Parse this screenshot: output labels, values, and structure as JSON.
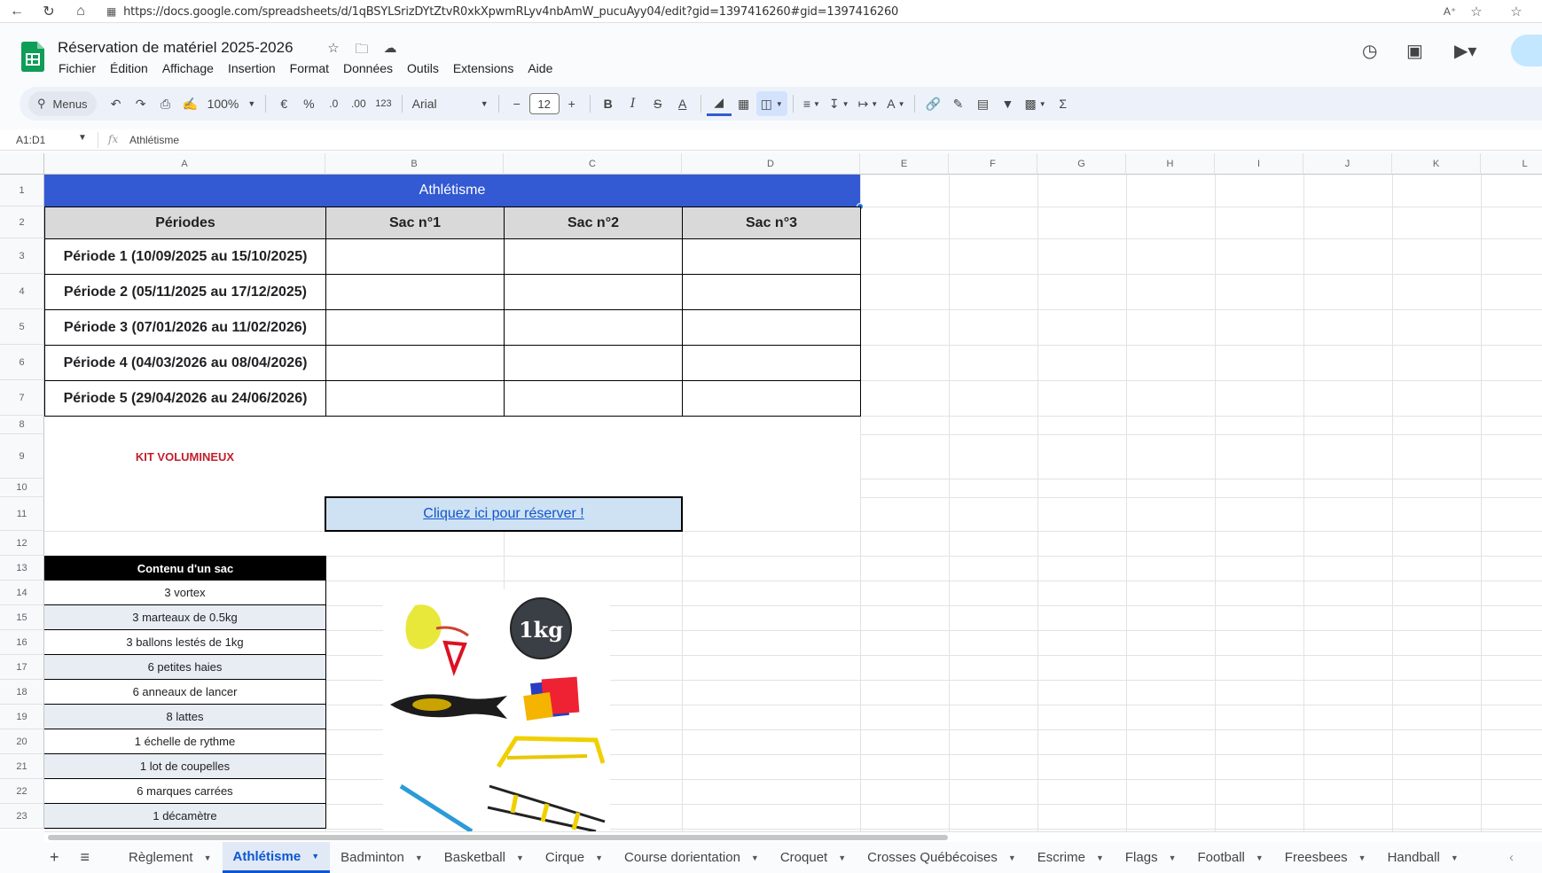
{
  "browser": {
    "url": "https://docs.google.com/spreadsheets/d/1qBSYLSrizDYtZtvR0xkXpwmRLyv4nbAmW_pucuAyy04/edit?gid=1397416260#gid=1397416260"
  },
  "header": {
    "title": "Réservation de matériel 2025-2026",
    "menu": [
      "Fichier",
      "Édition",
      "Affichage",
      "Insertion",
      "Format",
      "Données",
      "Outils",
      "Extensions",
      "Aide"
    ]
  },
  "toolbar": {
    "search_label": "Menus",
    "zoom": "100%",
    "currency": "€",
    "percent": "%",
    "dec_decrease": ".0",
    "dec_increase": ".00",
    "number_format": "123",
    "font": "Arial",
    "font_size": "12"
  },
  "formula_bar": {
    "name_box": "A1:D1",
    "content": "Athlétisme"
  },
  "grid": {
    "columns": [
      "A",
      "B",
      "C",
      "D",
      "E",
      "F",
      "G",
      "H",
      "I",
      "J",
      "K",
      "L"
    ],
    "rows": [
      "1",
      "2",
      "3",
      "4",
      "5",
      "6",
      "7",
      "8",
      "9",
      "10",
      "11",
      "12",
      "13",
      "14",
      "15",
      "16",
      "17",
      "18",
      "19",
      "20",
      "21",
      "22",
      "23"
    ],
    "title": "Athlétisme",
    "table_headers": [
      "Périodes",
      "Sac n°1",
      "Sac n°2",
      "Sac n°3"
    ],
    "periods": [
      "Période 1 (10/09/2025 au 15/10/2025)",
      "Période 2 (05/11/2025 au 17/12/2025)",
      "Période 3 (07/01/2026 au 11/02/2026)",
      "Période 4 (04/03/2026 au 08/04/2026)",
      "Période 5 (29/04/2026 au 24/06/2026)"
    ],
    "kit_label": "KIT VOLUMINEUX",
    "reserve_link": "Cliquez ici pour réserver !",
    "content_header": "Contenu d'un sac",
    "content_items": [
      "3 vortex",
      "3 marteaux de 0.5kg",
      "3 ballons lestés de 1kg",
      "6 petites haies",
      "6 anneaux de lancer",
      "8 lattes",
      "1 échelle de rythme",
      "1 lot de coupelles",
      "6 marques carrées",
      "1 décamètre"
    ],
    "ball_label": "1kg"
  },
  "sheet_tabs": [
    {
      "label": "Règlement",
      "active": false
    },
    {
      "label": "Athlétisme",
      "active": true
    },
    {
      "label": "Badminton",
      "active": false
    },
    {
      "label": "Basketball",
      "active": false
    },
    {
      "label": "Cirque",
      "active": false
    },
    {
      "label": "Course dorientation",
      "active": false
    },
    {
      "label": "Croquet",
      "active": false
    },
    {
      "label": "Crosses Québécoises",
      "active": false
    },
    {
      "label": "Escrime",
      "active": false
    },
    {
      "label": "Flags",
      "active": false
    },
    {
      "label": "Football",
      "active": false
    },
    {
      "label": "Freesbees",
      "active": false
    },
    {
      "label": "Handball",
      "active": false
    }
  ],
  "colors": {
    "title_bg": "#3359d3",
    "header_bg": "#d9d9d9",
    "kit_red": "#c0202c",
    "link_blue": "#1155cc",
    "link_bg": "#cfe2f3",
    "content_header_bg": "#000000",
    "alt_row_bg": "#e8ecf3"
  }
}
